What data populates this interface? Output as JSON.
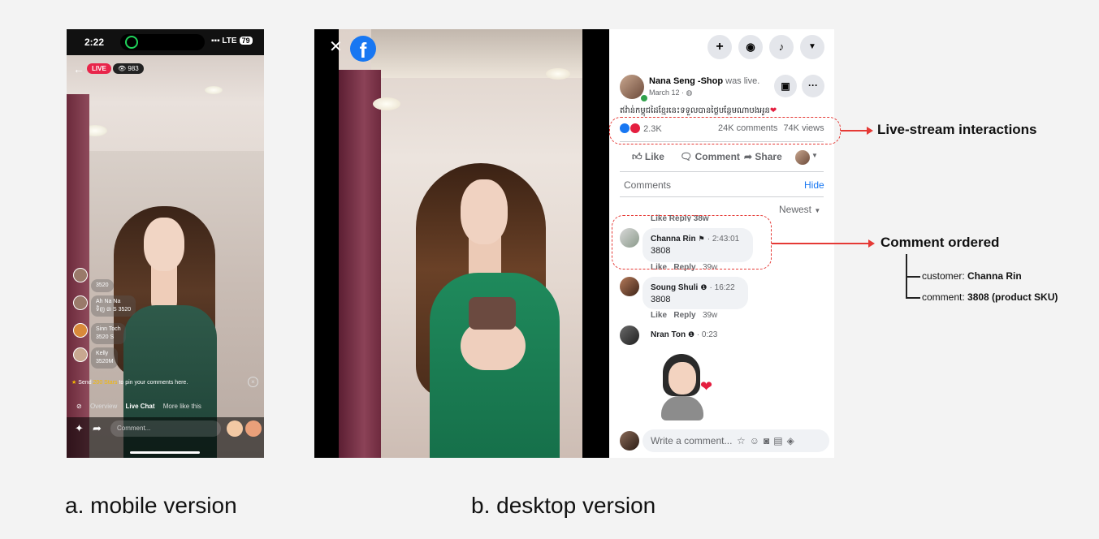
{
  "mobile": {
    "status_time": "2:22",
    "status_right": "LTE",
    "battery": "79",
    "live_badge": "LIVE",
    "viewer_count": "983",
    "comments": [
      {
        "name": "",
        "text": "3520"
      },
      {
        "name": "Ah Na Na",
        "text": "ទិញ ៣ S 3520"
      },
      {
        "name": "Sinn Toch",
        "text": "3520 S"
      },
      {
        "name": "Kelly",
        "text": "3520M"
      }
    ],
    "stars_prefix": "Send ",
    "stars_highlight": "200 Stars",
    "stars_suffix": " to pin your comments here.",
    "tabs": [
      "Overview",
      "Live Chat",
      "More like this"
    ],
    "comment_placeholder": "Comment..."
  },
  "desktop": {
    "page_name": "Nana Seng -Shop",
    "was_live": "was live.",
    "date": "March 12 · ",
    "post_text": "ឥវ៉ាន់កម្ពុជដៃខ្មែរនេះទទួលបានថ្លៃបន្ថែមណាបងអូន",
    "reaction_count": "2.3K",
    "comments_count": "24K comments",
    "views_count": "74K views",
    "actions": {
      "like": "Like",
      "comment": "Comment",
      "share": "Share"
    },
    "comments_label": "Comments",
    "hide_label": "Hide",
    "sort_label": "Newest",
    "prev_meta": "Like   Reply   38w",
    "comments": [
      {
        "name": "Channa Rin",
        "time": "2:43:01",
        "text": "3808",
        "meta_like": "Like",
        "meta_reply": "Reply",
        "meta_age": "39w"
      },
      {
        "name": "Soung Shuli",
        "time": "16:22",
        "text": "3808",
        "meta_like": "Like",
        "meta_reply": "Reply",
        "meta_age": "39w"
      },
      {
        "name": "Nran Ton",
        "time": "0:23",
        "text": ""
      }
    ],
    "write_placeholder": "Write a comment..."
  },
  "annotations": {
    "interactions_label": "Live-stream interactions",
    "ordered_label": "Comment ordered",
    "customer_prefix": "customer: ",
    "customer_value": "Channa Rin",
    "comment_prefix": "comment: ",
    "comment_value": "3808 (product SKU)",
    "color": "#e53935"
  },
  "captions": {
    "mobile": "a. mobile version",
    "desktop": "b. desktop version"
  },
  "colors": {
    "facebook_blue": "#1877f2",
    "live_red": "#e8254a",
    "love_red": "#e41e3f"
  }
}
